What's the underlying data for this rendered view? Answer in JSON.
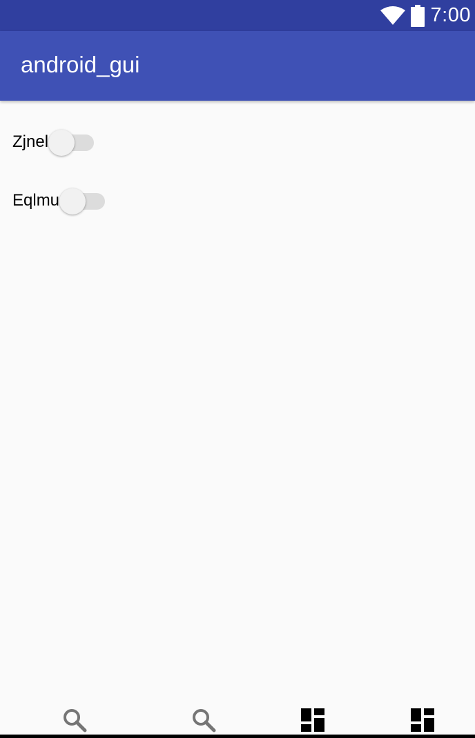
{
  "status_bar": {
    "time": "7:00",
    "icons": [
      "wifi-icon",
      "battery-icon"
    ],
    "background": "#303f9f"
  },
  "app_bar": {
    "title": "android_gui",
    "background": "#3f51b5"
  },
  "switches": [
    {
      "label": "Zjnel",
      "checked": false
    },
    {
      "label": "Eqlmu",
      "checked": false
    }
  ],
  "bottom_nav": {
    "icons": [
      "search-icon",
      "search-icon",
      "dashboard-icon",
      "dashboard-icon"
    ]
  },
  "colors": {
    "background": "#fafafa",
    "switch_thumb": "#f1f1f1",
    "switch_track": "#b9b9b9"
  }
}
